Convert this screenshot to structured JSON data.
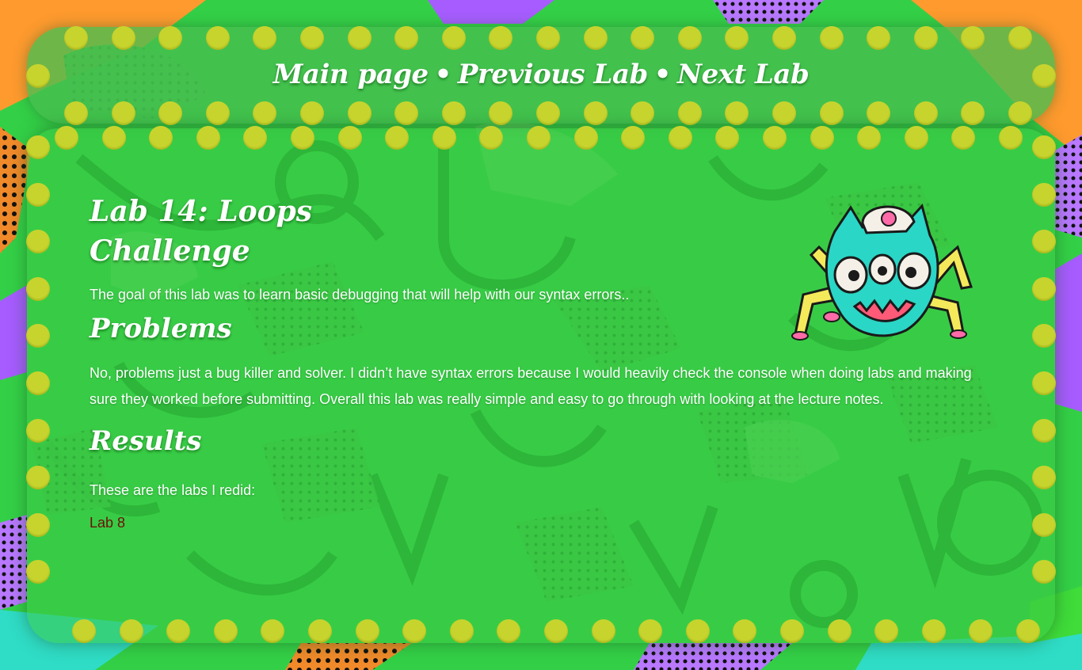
{
  "nav": {
    "links": [
      "Main page",
      "Previous Lab",
      "Next Lab"
    ],
    "separator": "•"
  },
  "page": {
    "title_line1": "Lab 14: Loops",
    "title_line2": "Challenge",
    "intro": "The goal of this lab was to learn basic debugging that will help with our syntax errors..",
    "problems_heading": "Problems",
    "problems_text": "No, problems just a bug killer and solver. I didn’t have syntax errors because I would heavily check the console when doing labs and making sure they worked before submitting. Overall this lab was really simple and easy to go through with looking at the lecture notes.",
    "results_heading": "Results",
    "results_text": "These are the labs I redid:",
    "results_link": "Lab 8"
  },
  "colors": {
    "bulb": "#c8d42e",
    "link": "#6b1208",
    "panel": "#46be50"
  },
  "icons": [
    "monster-illustration"
  ]
}
